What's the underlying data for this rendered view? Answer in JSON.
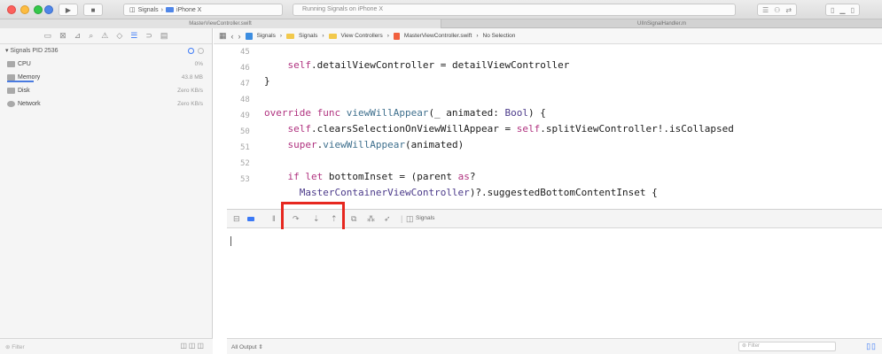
{
  "toolbar": {
    "scheme_target": "Signals",
    "device": "iPhone X",
    "activity_text": "Running Signals on iPhone X"
  },
  "tabs": {
    "active": "MasterViewController.swift",
    "other": "UIInSignalHandler.m"
  },
  "navigator": {
    "process": "Signals PID 2536",
    "gauges": [
      {
        "label": "CPU",
        "value": "0%"
      },
      {
        "label": "Memory",
        "value": "43.8 MB"
      },
      {
        "label": "Disk",
        "value": "Zero KB/s"
      },
      {
        "label": "Network",
        "value": "Zero KB/s"
      }
    ],
    "filter_placeholder": "Filter"
  },
  "jumpbar": {
    "crumbs": [
      "Signals",
      "Signals",
      "View Controllers",
      "MasterViewController.swift",
      "No Selection"
    ]
  },
  "editor": {
    "line_numbers": [
      "45",
      "46",
      "47",
      "48",
      "49",
      "50",
      "51",
      "52",
      "53",
      ""
    ]
  },
  "debug": {
    "target": "Signals"
  },
  "console": {
    "output_selector": "All Output",
    "filter_placeholder": "Filter"
  }
}
